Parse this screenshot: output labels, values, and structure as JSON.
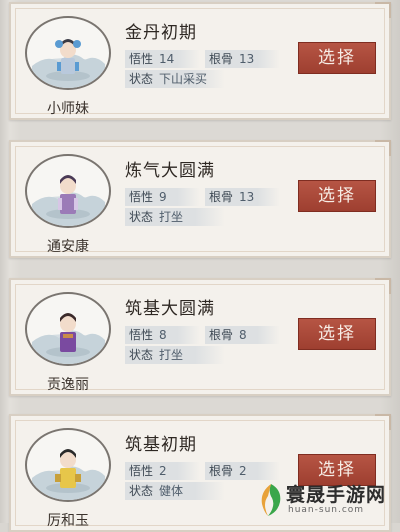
{
  "button_label": "选择",
  "stat_labels": {
    "insight": "悟性",
    "bone": "根骨",
    "status": "状态"
  },
  "characters": [
    {
      "name": "小师妹",
      "realm": "金丹初期",
      "insight": "14",
      "bone": "13",
      "status": "下山采买",
      "robe": "#b9c9dc",
      "accent": "#5a9bd2",
      "hair": "#3a3a44"
    },
    {
      "name": "通安康",
      "realm": "炼气大圆满",
      "insight": "9",
      "bone": "13",
      "status": "打坐",
      "robe": "#9b7bb7",
      "accent": "#d7c6e6",
      "hair": "#4a3a55"
    },
    {
      "name": "贡逸丽",
      "realm": "筑基大圆满",
      "insight": "8",
      "bone": "8",
      "status": "打坐",
      "robe": "#7a4aa0",
      "accent": "#c98b4a",
      "hair": "#3b2a2a"
    },
    {
      "name": "厉和玉",
      "realm": "筑基初期",
      "insight": "2",
      "bone": "2",
      "status": "健体",
      "robe": "#e7c64a",
      "accent": "#c8a03a",
      "hair": "#2a2a2a"
    }
  ],
  "watermark": {
    "name": "寰晟手游网",
    "url": "huan-sun.com"
  }
}
